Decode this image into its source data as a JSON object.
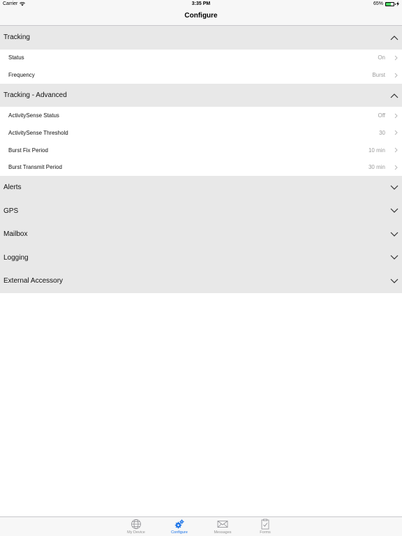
{
  "status_bar": {
    "carrier": "Carrier",
    "time": "3:35 PM",
    "battery_text": "65%",
    "battery_level": 0.65
  },
  "nav": {
    "title": "Configure"
  },
  "sections": {
    "tracking": {
      "title": "Tracking",
      "expanded": true,
      "rows": [
        {
          "label": "Status",
          "value": "On"
        },
        {
          "label": "Frequency",
          "value": "Burst"
        }
      ]
    },
    "tracking_advanced": {
      "title": "Tracking - Advanced",
      "expanded": true,
      "rows": [
        {
          "label": "ActivitySense Status",
          "value": "Off"
        },
        {
          "label": "ActivitySense Threshold",
          "value": "30"
        },
        {
          "label": "Burst Fix Period",
          "value": "10 min"
        },
        {
          "label": "Burst Transmit Period",
          "value": "30 min"
        }
      ]
    },
    "alerts": {
      "title": "Alerts",
      "expanded": false
    },
    "gps": {
      "title": "GPS",
      "expanded": false
    },
    "mailbox": {
      "title": "Mailbox",
      "expanded": false
    },
    "logging": {
      "title": "Logging",
      "expanded": false
    },
    "external_accessory": {
      "title": "External Accessory",
      "expanded": false
    }
  },
  "tabs": [
    {
      "label": "My Device",
      "icon": "globe-icon",
      "active": false
    },
    {
      "label": "Configure",
      "icon": "gears-icon",
      "active": true
    },
    {
      "label": "Messages",
      "icon": "envelope-icon",
      "active": false
    },
    {
      "label": "Forms",
      "icon": "clipboard-icon",
      "active": false
    }
  ],
  "colors": {
    "accent": "#1a73e8",
    "section_bg": "#e8e8e8",
    "value_text": "#9b9b9b",
    "battery_green": "#4cd964"
  }
}
